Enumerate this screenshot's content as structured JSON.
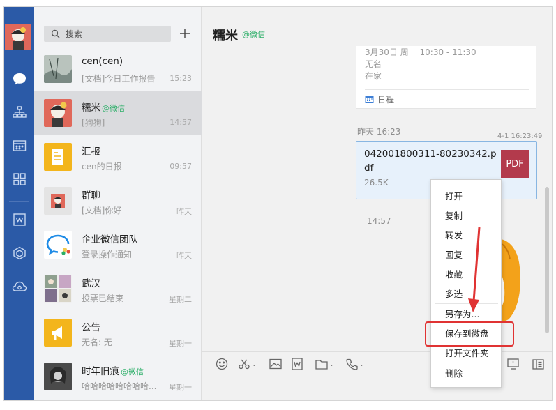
{
  "search": {
    "placeholder": "搜索"
  },
  "conversations": [
    {
      "name": "cen(cen)",
      "tag": "",
      "preview": "[文档]今日工作报告",
      "time": "15:23"
    },
    {
      "name": "糯米",
      "tag": "@微信",
      "preview": "[狗狗]",
      "time": "14:57"
    },
    {
      "name": "汇报",
      "tag": "",
      "preview": "cen的日报",
      "time": "09:57"
    },
    {
      "name": "群聊",
      "tag": "",
      "preview": "[文档]你好",
      "time": "昨天"
    },
    {
      "name": "企业微信团队",
      "tag": "",
      "preview": "登录操作通知",
      "time": "昨天"
    },
    {
      "name": "武汉",
      "tag": "",
      "preview": "投票已结束",
      "time": "星期二"
    },
    {
      "name": "公告",
      "tag": "",
      "preview": "无名: 无",
      "time": "星期一"
    },
    {
      "name": "时年旧痕",
      "tag": "@微信",
      "preview": "哈哈哈哈哈哈哈哈...",
      "time": "星期一"
    }
  ],
  "chat": {
    "title": "糯米",
    "title_tag": "@微信",
    "schedule": {
      "time_line": "3月30日 周一 10:30 - 11:30",
      "line2": "无名",
      "line3": "在家",
      "footer": "日程"
    },
    "stamp_yesterday": "昨天 16:23",
    "file_stamp": "4-1 16:23:49",
    "file": {
      "name": "042001800311-80230342.pdf",
      "size": "26.5K",
      "badge": "PDF"
    },
    "stamp_today": "14:57"
  },
  "context_menu": {
    "items": [
      "打开",
      "复制",
      "转发",
      "回复",
      "收藏",
      "多选",
      "另存为...",
      "保存到微盘",
      "打开文件夹",
      "删除"
    ]
  },
  "colors": {
    "rail": "#2b5aa7",
    "highlight": "#e03333",
    "pdf_badge": "#b33a4c",
    "wechat_tag": "#2aae67"
  }
}
